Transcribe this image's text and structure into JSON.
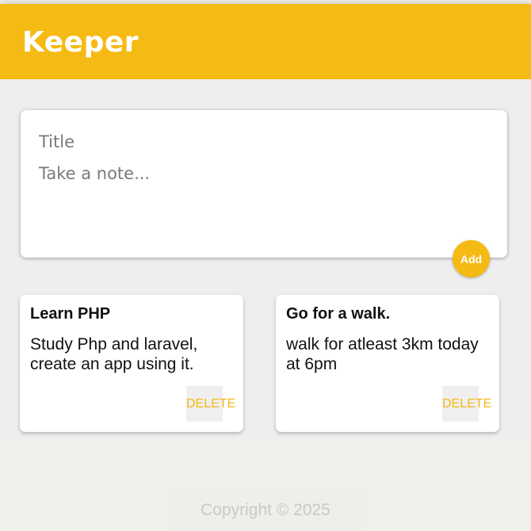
{
  "header": {
    "title": "Keeper"
  },
  "composer": {
    "title_placeholder": "Title",
    "content_placeholder": "Take a note...",
    "add_label": "Add"
  },
  "notes": [
    {
      "title": "Learn PHP",
      "content": "Study Php and laravel, create an app using it.",
      "delete_label": "DELETE"
    },
    {
      "title": "Go for a walk.",
      "content": "walk for atleast 3km today at 6pm",
      "delete_label": "DELETE"
    }
  ],
  "footer": {
    "copyright": "Copyright © 2025"
  },
  "colors": {
    "accent": "#f5ba13",
    "background": "#eeeeee"
  }
}
